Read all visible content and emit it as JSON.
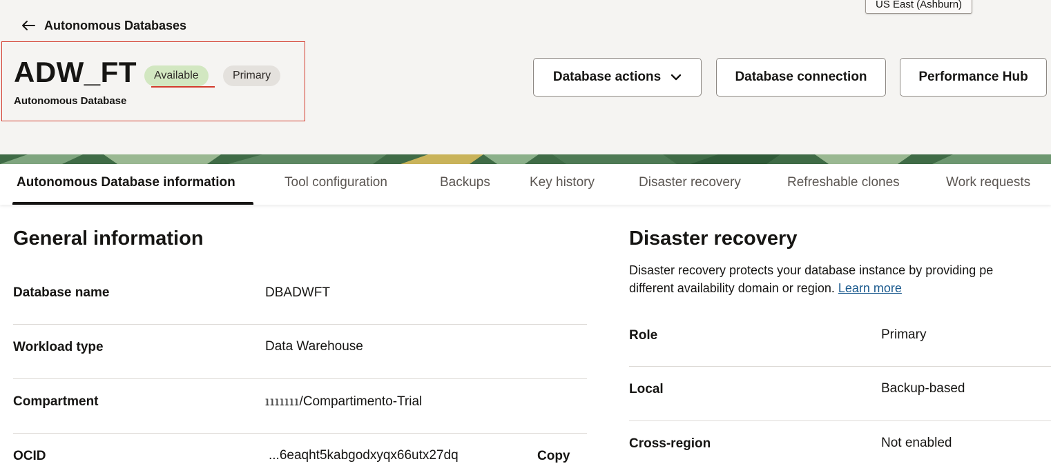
{
  "header": {
    "region": "US East (Ashburn)",
    "back_label": "Autonomous Databases",
    "db_name": "ADW_FT",
    "status_badge": "Available",
    "role_badge": "Primary",
    "subtitle": "Autonomous Database",
    "actions": {
      "database_actions": "Database actions",
      "database_connection": "Database connection",
      "performance_hub": "Performance Hub"
    }
  },
  "tabs": [
    {
      "label": "Autonomous Database information",
      "active": true
    },
    {
      "label": "Tool configuration"
    },
    {
      "label": "Backups"
    },
    {
      "label": "Key history"
    },
    {
      "label": "Disaster recovery"
    },
    {
      "label": "Refreshable clones"
    },
    {
      "label": "Work requests"
    }
  ],
  "general": {
    "title": "General information",
    "rows": [
      {
        "label": "Database name",
        "value": "DBADWFT"
      },
      {
        "label": "Workload type",
        "value": "Data Warehouse"
      },
      {
        "label": "Compartment",
        "value_masked": "ııııııı",
        "value": "/Compartimento-Trial"
      },
      {
        "label": "OCID",
        "value": "...6eaqht5kabgodxyqx66utx27dq",
        "action": "Copy"
      }
    ]
  },
  "disaster_recovery": {
    "title": "Disaster recovery",
    "description_line1": "Disaster recovery protects your database instance by providing pe",
    "description_line2": "different availability domain or region.",
    "learn_more": "Learn more",
    "rows": [
      {
        "label": "Role",
        "value": "Primary"
      },
      {
        "label": "Local",
        "value": "Backup-based"
      },
      {
        "label": "Cross-region",
        "value": "Not enabled"
      }
    ]
  },
  "colors": {
    "available_badge": "#d2e7c1",
    "primary_badge": "#e4e1dd",
    "highlight_border": "#d33a2c",
    "link": "#1b5a8e"
  }
}
